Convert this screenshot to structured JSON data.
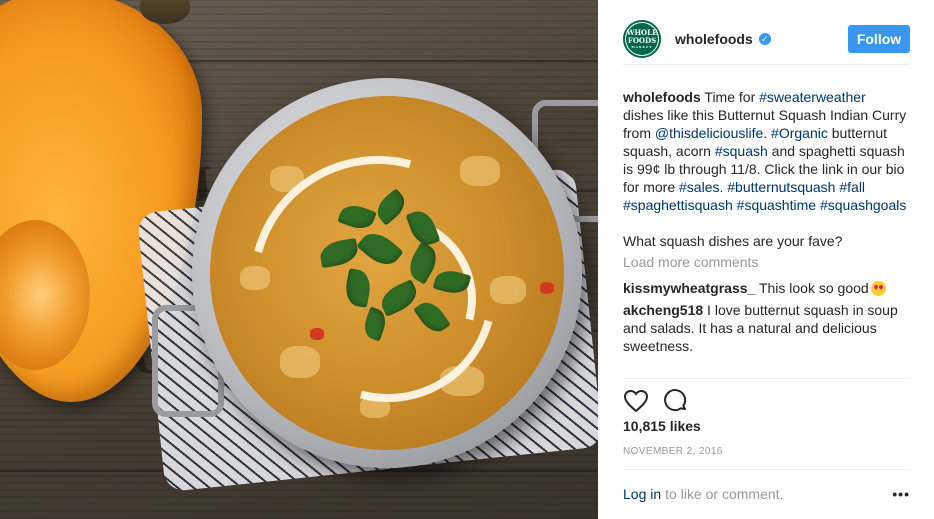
{
  "post": {
    "account": {
      "username": "wholefoods",
      "avatar_line1": "WHOLE",
      "avatar_line2": "FOODS",
      "avatar_line3": "MARKET",
      "avatar_color": "#00674b",
      "verified_icon": "verified-badge-icon"
    },
    "follow_label": "Follow",
    "caption": {
      "username": "wholefoods",
      "t1": " Time for ",
      "h1": "#sweaterweather",
      "t2": " dishes like this Butternut Squash Indian Curry from ",
      "m1": "@thisdeliciouslife",
      "t3": ". ",
      "h2": "#Organic",
      "t4": " butternut squash, acorn ",
      "h3": "#squash",
      "t5": " and spaghetti squash is 99¢ lb through 11/8. Click the link in our bio for more ",
      "h4": "#sales",
      "t6": ". ",
      "h5": "#butternutsquash",
      "t7": " ",
      "h6": "#fall",
      "t8": " ",
      "h7": "#spaghettisquash",
      "t9": " ",
      "h8": "#squashtime",
      "t10": " ",
      "h9": "#squashgoals"
    },
    "question": "What squash dishes are your fave?",
    "load_more": "Load more comments",
    "comments": [
      {
        "user": "kissmywheatgrass_",
        "text": " This look so good"
      },
      {
        "user": "akcheng518",
        "text": " I love butternut squash in soup and salads. It has a natural and delicious sweetness."
      }
    ],
    "likes": "10,815 likes",
    "date": "NOVEMBER 2, 2016",
    "footer": {
      "login": "Log in",
      "text": "to like or comment.",
      "more": "•••"
    },
    "icons": {
      "like": "heart-icon",
      "comment": "speech-bubble-icon",
      "emoji": "heart-eyes-emoji-icon"
    },
    "colors": {
      "accent": "#3897f0",
      "link": "#003569",
      "muted": "#999999",
      "text": "#262626"
    }
  }
}
